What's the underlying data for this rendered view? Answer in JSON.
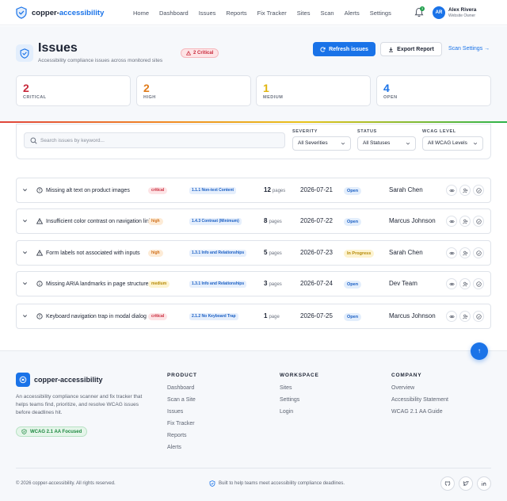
{
  "header": {
    "brand_prefix": "copper-",
    "brand_suffix": "accessibility",
    "nav": [
      "Home",
      "Dashboard",
      "Issues",
      "Reports",
      "Fix Tracker",
      "Sites",
      "Scan",
      "Alerts",
      "Settings"
    ],
    "notification_count": "3",
    "user": {
      "initials": "AR",
      "name": "Alex Rivera",
      "role": "Website Owner"
    }
  },
  "page": {
    "title": "Issues",
    "subtitle": "Accessibility compliance issues across monitored sites",
    "critical_pill": "2 Critical",
    "refresh_label": "Refresh issues",
    "export_label": "Export Report",
    "scan_settings_label": "Scan Settings →"
  },
  "stats": [
    {
      "value": "2",
      "label": "CRITICAL",
      "color": "#c8283a"
    },
    {
      "value": "2",
      "label": "HIGH",
      "color": "#e07b1a"
    },
    {
      "value": "1",
      "label": "MEDIUM",
      "color": "#e0b40e"
    },
    {
      "value": "4",
      "label": "OPEN",
      "color": "#1a73e8"
    }
  ],
  "filters": {
    "search_placeholder": "Search issues by keyword...",
    "severity_label": "SEVERITY",
    "severity_value": "All Severities",
    "status_label": "STATUS",
    "status_value": "All Statuses",
    "wcag_label": "WCAG LEVEL",
    "wcag_value": "All WCAG Levels"
  },
  "issues": [
    {
      "title": "Missing alt text on product images",
      "severity": "critical",
      "wcag": "1.1.1 Non-text Content",
      "pages": "12",
      "pages_unit": "pages",
      "date": "2026-07-21",
      "status": "Open",
      "assignee": "Sarah Chen"
    },
    {
      "title": "Insufficient color contrast on navigation links",
      "severity": "high",
      "wcag": "1.4.3 Contrast (Minimum)",
      "pages": "8",
      "pages_unit": "pages",
      "date": "2026-07-22",
      "status": "Open",
      "assignee": "Marcus Johnson"
    },
    {
      "title": "Form labels not associated with inputs",
      "severity": "high",
      "wcag": "1.3.1 Info and Relationships",
      "pages": "5",
      "pages_unit": "pages",
      "date": "2026-07-23",
      "status": "In Progress",
      "assignee": "Sarah Chen"
    },
    {
      "title": "Missing ARIA landmarks in page structure",
      "severity": "medium",
      "wcag": "1.3.1 Info and Relationships",
      "pages": "3",
      "pages_unit": "pages",
      "date": "2026-07-24",
      "status": "Open",
      "assignee": "Dev Team"
    },
    {
      "title": "Keyboard navigation trap in modal dialog",
      "severity": "critical",
      "wcag": "2.1.2 No Keyboard Trap",
      "pages": "1",
      "pages_unit": "page",
      "date": "2026-07-25",
      "status": "Open",
      "assignee": "Marcus Johnson"
    }
  ],
  "footer": {
    "brand": "copper-accessibility",
    "description": "An accessibility compliance scanner and fix tracker that helps teams find, prioritize, and resolve WCAG issues before deadlines hit.",
    "badge": "WCAG 2.1 AA Focused",
    "product_title": "PRODUCT",
    "product_links": [
      "Dashboard",
      "Scan a Site",
      "Issues",
      "Fix Tracker",
      "Reports",
      "Alerts"
    ],
    "workspace_title": "WORKSPACE",
    "workspace_links": [
      "Sites",
      "Settings",
      "Login"
    ],
    "company_title": "COMPANY",
    "company_links": [
      "Overview",
      "Accessibility Statement",
      "WCAG 2.1 AA Guide"
    ],
    "copyright": "© 2026 copper-accessibility. All rights reserved.",
    "tagline": "Built to help teams meet accessibility compliance deadlines.",
    "fab_label": "↑"
  }
}
